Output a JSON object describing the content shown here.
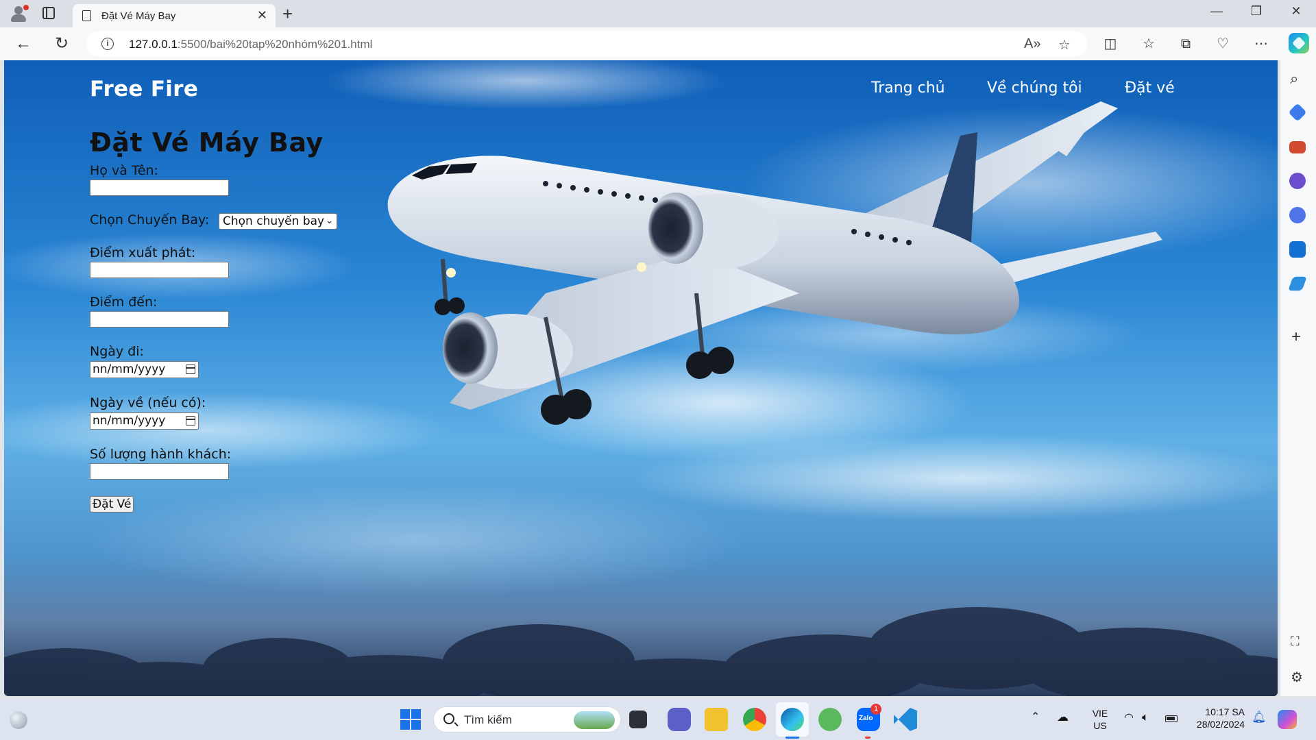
{
  "browser": {
    "tab_title": "Đặt Vé Máy Bay",
    "url_host": "127.0.0.1",
    "url_path": ":5500/bai%20tap%20nhóm%201.html"
  },
  "site": {
    "brand": "Free Fire",
    "nav": [
      "Trang chủ",
      "Về chúng tôi",
      "Đặt vé"
    ],
    "heading": "Đặt Vé Máy Bay",
    "form": {
      "name_label": "Họ và Tên:",
      "flight_label": "Chọn Chuyến Bay:",
      "flight_selected": "Chọn chuyến bay",
      "from_label": "Điểm xuất phát:",
      "to_label": "Điểm đến:",
      "depart_label": "Ngày đi:",
      "return_label": "Ngày về (nếu có):",
      "date_placeholder": "nn/mm/yyyy",
      "passengers_label": "Số lượng hành khách:",
      "submit_label": "Đặt Vé"
    }
  },
  "taskbar": {
    "search_text": "Tìm kiếm",
    "lang_line1": "VIE",
    "lang_line2": "US",
    "time": "10:17 SA",
    "date": "28/02/2024",
    "zalo_badge": "1",
    "zalo_label": "Zalo"
  }
}
